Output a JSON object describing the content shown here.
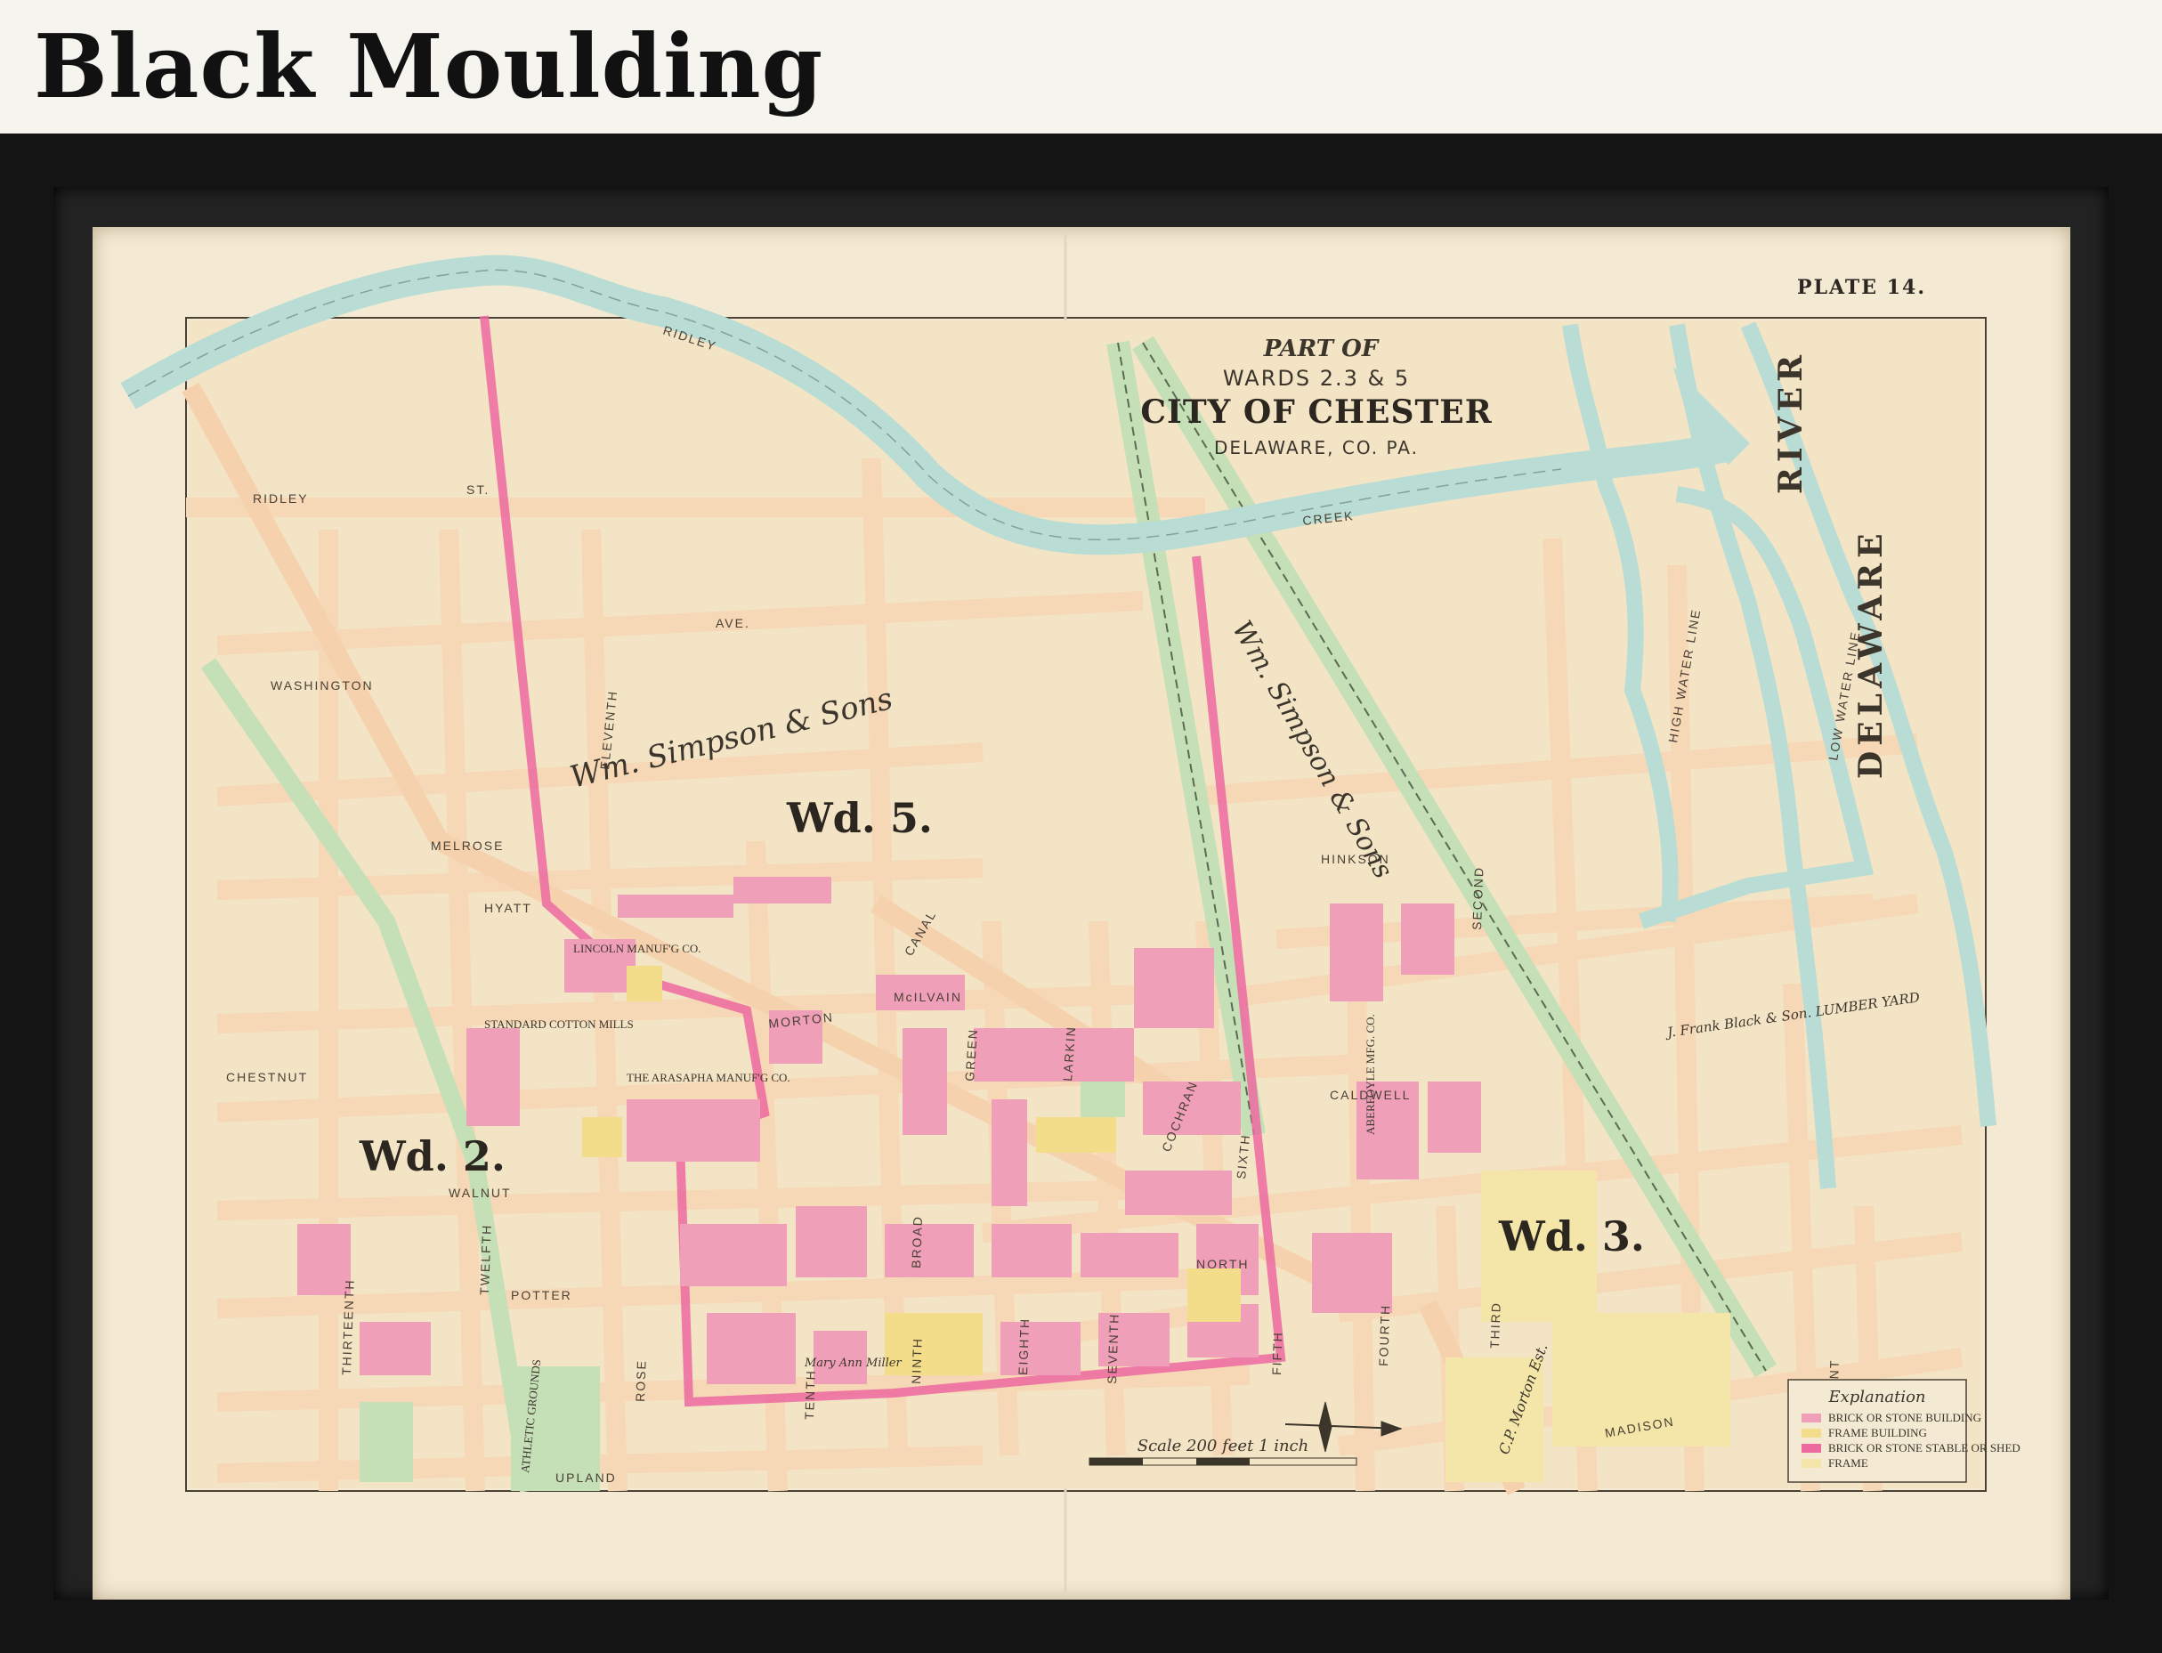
{
  "header": {
    "title": "Black Moulding"
  },
  "map": {
    "plate": "PLATE 14.",
    "title_part": "PART OF",
    "title_wards": "WARDS 2.3 & 5",
    "title_city": "CITY OF CHESTER",
    "title_county": "DELAWARE, CO. PA.",
    "wards": [
      "Wd. 5.",
      "Wd. 2.",
      "Wd. 3."
    ],
    "waterways": [
      "RIDLEY",
      "CREEK",
      "DELAWARE",
      "RIVER",
      "HIGH WATER LINE",
      "LOW WATER LINE"
    ],
    "streets": [
      "RIDLEY",
      "ST.",
      "WASHINGTON",
      "AVE.",
      "MELROSE",
      "HYATT",
      "CHESTNUT",
      "WALNUT",
      "POTTER",
      "UPLAND",
      "THIRTEENTH",
      "TWELFTH",
      "ELEVENTH",
      "TENTH",
      "NINTH",
      "BROAD",
      "EIGHTH",
      "SEVENTH",
      "SIXTH",
      "FIFTH",
      "FOURTH",
      "THIRD",
      "SECOND",
      "FRONT",
      "MORTON",
      "CALDWELL",
      "HINKSON",
      "CANAL",
      "MADISON",
      "LARKIN",
      "COCHRAN",
      "GREEN",
      "NORTH",
      "ROSE",
      "McILVAIN"
    ],
    "businesses": [
      "Wm. Simpson & Sons",
      "STANDARD COTTON MILLS",
      "THE ARASAPHA MANUF'G CO.",
      "ABERFOYLE MFG. CO.",
      "J. Frank Black & Son. LUMBER YARD",
      "ATHLETIC GROUNDS",
      "LINCOLN MANUF'G CO.",
      "C.P. Morton Est.",
      "Mary Ann Miller"
    ],
    "scale": "Scale 200 feet 1 inch",
    "legend": {
      "title": "Explanation",
      "items": [
        "BRICK OR STONE BUILDING",
        "FRAME BUILDING",
        "BRICK OR STONE STABLE OR SHED",
        "FRAME"
      ],
      "colors": [
        "#ef9fb7",
        "#f3dc8a",
        "#ec6aa0",
        "#f4e6a8"
      ]
    },
    "colors": {
      "mat": "#f4ead4",
      "street": "#f6dcbc",
      "water": "#b9dcd4",
      "railroad": "#c5dfb7",
      "brick": "#ef9fb7",
      "frame": "#f3dc8a",
      "boundary": "#ec6aa0"
    }
  }
}
